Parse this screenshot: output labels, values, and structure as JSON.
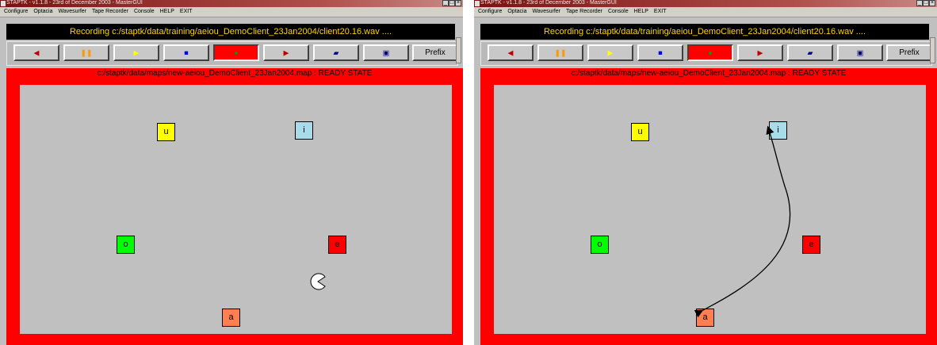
{
  "colors": {
    "titlebar": "#7a1210",
    "status_text": "#ffd400",
    "map_border": "#ff0000",
    "map_background": "#c0c0c0",
    "vowel_u": "#ffff00",
    "vowel_i": "#a9dceb",
    "vowel_o": "#00ff00",
    "vowel_e": "#ff0000",
    "vowel_a": "#ff7f50"
  },
  "windows": [
    {
      "title": "STAPTK - v1.1.8 - 23rd of December 2003 - MasterGUI",
      "window_buttons": [
        "_",
        "□",
        "×"
      ],
      "menu": [
        "Configure",
        "Optacia",
        "Wavesurfer",
        "Tape Recorder",
        "Console",
        "HELP",
        "EXIT"
      ],
      "status": "Recording c:/staptk/data/training/aeiou_DemoClient_23Jan2004/client20.16.wav ....",
      "toolbar": {
        "buttons": [
          {
            "icon": "skip-back-icon",
            "glyph": "◀"
          },
          {
            "icon": "pause-icon",
            "glyph": "❚❚"
          },
          {
            "icon": "play-icon",
            "glyph": "▶"
          },
          {
            "icon": "stop-icon",
            "glyph": "■"
          },
          {
            "icon": "record-icon",
            "glyph": "●"
          },
          {
            "icon": "skip-forward-icon",
            "glyph": "▶"
          },
          {
            "icon": "open-folder-icon",
            "glyph": "▰"
          },
          {
            "icon": "save-icon",
            "glyph": "▣"
          }
        ],
        "prefix_label": "Prefix"
      },
      "map_title": "c:/staptk/data/maps/new-aeiou_DemoClient_23Jan2004.map : READY STATE",
      "vowels": {
        "u": "u",
        "i": "i",
        "o": "o",
        "e": "e",
        "a": "a"
      },
      "cursor": "pacman-cursor-icon"
    },
    {
      "title": "STAPTK - v1.1.8 - 23rd of December 2003 - MasterGUI",
      "window_buttons": [
        "_",
        "□",
        "×"
      ],
      "menu": [
        "Configure",
        "Optacia",
        "Wavesurfer",
        "Tape Recorder",
        "Console",
        "HELP",
        "EXIT"
      ],
      "status": "Recording c:/staptk/data/training/aeiou_DemoClient_23Jan2004/client20.16.wav ....",
      "toolbar": {
        "buttons": [
          {
            "icon": "skip-back-icon",
            "glyph": "◀"
          },
          {
            "icon": "pause-icon",
            "glyph": "❚❚"
          },
          {
            "icon": "play-icon",
            "glyph": "▶"
          },
          {
            "icon": "stop-icon",
            "glyph": "■"
          },
          {
            "icon": "record-icon",
            "glyph": "●"
          },
          {
            "icon": "skip-forward-icon",
            "glyph": "▶"
          },
          {
            "icon": "open-folder-icon",
            "glyph": "▰"
          },
          {
            "icon": "save-icon",
            "glyph": "▣"
          }
        ],
        "prefix_label": "Prefix"
      },
      "map_title": "c:/staptk/data/maps/new-aeiou_DemoClient_23Jan2004.map : READY STATE",
      "vowels": {
        "u": "u",
        "i": "i",
        "o": "o",
        "e": "e",
        "a": "a"
      },
      "trajectory": "a-to-i-arrow"
    }
  ]
}
